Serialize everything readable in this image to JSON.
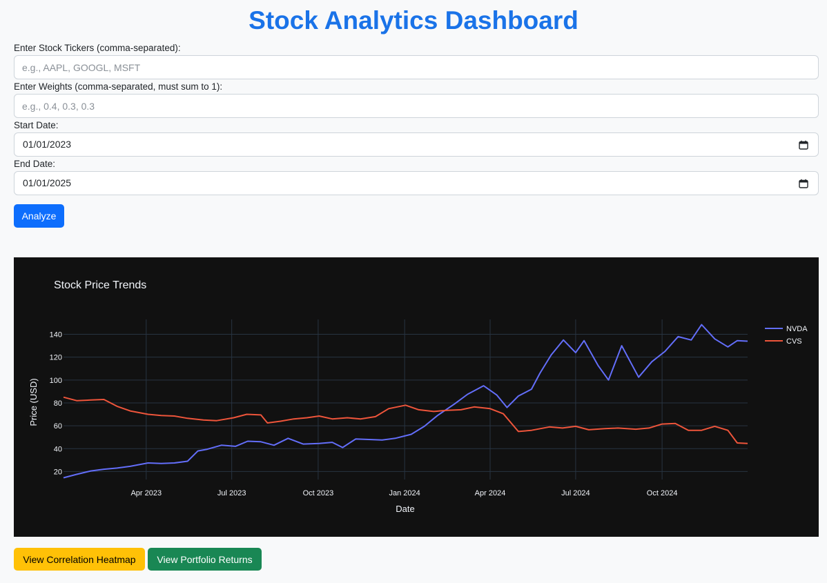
{
  "header": {
    "title": "Stock Analytics Dashboard"
  },
  "form": {
    "tickers_label": "Enter Stock Tickers (comma-separated):",
    "tickers_placeholder": "e.g., AAPL, GOOGL, MSFT",
    "tickers_value": "",
    "weights_label": "Enter Weights (comma-separated, must sum to 1):",
    "weights_placeholder": "e.g., 0.4, 0.3, 0.3",
    "weights_value": "",
    "start_label": "Start Date:",
    "start_value": "01/01/2023",
    "end_label": "End Date:",
    "end_value": "01/01/2025",
    "calendar_icon": "calendar-icon",
    "analyze_label": "Analyze"
  },
  "actions": {
    "heatmap_label": "View Correlation Heatmap",
    "portfolio_label": "View Portfolio Returns"
  },
  "colors": {
    "title": "#1a73e8",
    "primary": "#0d6efd",
    "warning": "#ffc107",
    "success": "#198754",
    "chart_bg": "#111111",
    "grid": "#283442"
  },
  "chart_data": {
    "type": "line",
    "title": "Stock Price Trends",
    "xlabel": "Date",
    "ylabel": "Price (USD)",
    "xlim": [
      "2023-01-03",
      "2024-12-31"
    ],
    "ylim": [
      13,
      153
    ],
    "yticks": [
      20,
      40,
      60,
      80,
      100,
      120,
      140
    ],
    "xticks": [
      {
        "date": "2023-04-01",
        "label": "Apr 2023"
      },
      {
        "date": "2023-07-01",
        "label": "Jul 2023"
      },
      {
        "date": "2023-10-01",
        "label": "Oct 2023"
      },
      {
        "date": "2024-01-01",
        "label": "Jan 2024"
      },
      {
        "date": "2024-04-01",
        "label": "Apr 2024"
      },
      {
        "date": "2024-07-01",
        "label": "Jul 2024"
      },
      {
        "date": "2024-10-01",
        "label": "Oct 2024"
      }
    ],
    "grid": true,
    "legend_position": "top-right",
    "series": [
      {
        "name": "NVDA",
        "color": "#636efa",
        "points": [
          [
            "2023-01-03",
            14.5
          ],
          [
            "2023-01-17",
            17.5
          ],
          [
            "2023-02-01",
            20.5
          ],
          [
            "2023-02-15",
            22.0
          ],
          [
            "2023-03-01",
            23.0
          ],
          [
            "2023-03-15",
            24.5
          ],
          [
            "2023-04-03",
            27.5
          ],
          [
            "2023-04-17",
            27.0
          ],
          [
            "2023-05-01",
            27.5
          ],
          [
            "2023-05-15",
            29.0
          ],
          [
            "2023-05-26",
            38.0
          ],
          [
            "2023-06-05",
            39.5
          ],
          [
            "2023-06-20",
            43.0
          ],
          [
            "2023-07-05",
            42.0
          ],
          [
            "2023-07-18",
            46.5
          ],
          [
            "2023-08-01",
            46.0
          ],
          [
            "2023-08-15",
            43.0
          ],
          [
            "2023-08-30",
            49.0
          ],
          [
            "2023-09-15",
            44.0
          ],
          [
            "2023-10-02",
            44.5
          ],
          [
            "2023-10-16",
            45.5
          ],
          [
            "2023-10-27",
            41.0
          ],
          [
            "2023-11-10",
            48.5
          ],
          [
            "2023-11-24",
            48.0
          ],
          [
            "2023-12-08",
            47.5
          ],
          [
            "2023-12-22",
            49.0
          ],
          [
            "2024-01-08",
            52.5
          ],
          [
            "2024-01-22",
            59.5
          ],
          [
            "2024-02-05",
            69.0
          ],
          [
            "2024-02-23",
            79.0
          ],
          [
            "2024-03-08",
            87.5
          ],
          [
            "2024-03-25",
            95.0
          ],
          [
            "2024-04-08",
            87.0
          ],
          [
            "2024-04-19",
            76.0
          ],
          [
            "2024-05-01",
            86.0
          ],
          [
            "2024-05-15",
            92.0
          ],
          [
            "2024-05-24",
            106.0
          ],
          [
            "2024-06-05",
            122.0
          ],
          [
            "2024-06-18",
            135.0
          ],
          [
            "2024-07-01",
            124.0
          ],
          [
            "2024-07-10",
            134.5
          ],
          [
            "2024-07-25",
            112.5
          ],
          [
            "2024-08-05",
            100.0
          ],
          [
            "2024-08-19",
            130.0
          ],
          [
            "2024-09-06",
            102.5
          ],
          [
            "2024-09-20",
            116.0
          ],
          [
            "2024-10-04",
            125.0
          ],
          [
            "2024-10-18",
            138.0
          ],
          [
            "2024-11-01",
            135.0
          ],
          [
            "2024-11-12",
            148.5
          ],
          [
            "2024-11-26",
            136.0
          ],
          [
            "2024-12-10",
            129.0
          ],
          [
            "2024-12-20",
            134.5
          ],
          [
            "2024-12-31",
            134.0
          ]
        ]
      },
      {
        "name": "CVS",
        "color": "#ef553b",
        "points": [
          [
            "2023-01-03",
            85.0
          ],
          [
            "2023-01-17",
            82.0
          ],
          [
            "2023-02-01",
            82.5
          ],
          [
            "2023-02-15",
            83.0
          ],
          [
            "2023-03-01",
            77.0
          ],
          [
            "2023-03-15",
            73.0
          ],
          [
            "2023-04-03",
            70.0
          ],
          [
            "2023-04-17",
            69.0
          ],
          [
            "2023-05-01",
            68.5
          ],
          [
            "2023-05-15",
            66.5
          ],
          [
            "2023-06-01",
            65.0
          ],
          [
            "2023-06-15",
            64.5
          ],
          [
            "2023-07-03",
            67.0
          ],
          [
            "2023-07-17",
            70.0
          ],
          [
            "2023-08-01",
            69.5
          ],
          [
            "2023-08-08",
            62.5
          ],
          [
            "2023-08-22",
            64.0
          ],
          [
            "2023-09-05",
            66.0
          ],
          [
            "2023-09-19",
            67.0
          ],
          [
            "2023-10-02",
            68.5
          ],
          [
            "2023-10-16",
            66.0
          ],
          [
            "2023-11-01",
            67.0
          ],
          [
            "2023-11-15",
            66.0
          ],
          [
            "2023-12-01",
            68.0
          ],
          [
            "2023-12-15",
            75.0
          ],
          [
            "2024-01-02",
            78.0
          ],
          [
            "2024-01-16",
            74.0
          ],
          [
            "2024-02-01",
            72.5
          ],
          [
            "2024-02-15",
            73.5
          ],
          [
            "2024-03-01",
            74.0
          ],
          [
            "2024-03-15",
            76.5
          ],
          [
            "2024-04-01",
            75.0
          ],
          [
            "2024-04-15",
            70.5
          ],
          [
            "2024-05-01",
            55.0
          ],
          [
            "2024-05-15",
            56.0
          ],
          [
            "2024-06-03",
            59.0
          ],
          [
            "2024-06-17",
            58.0
          ],
          [
            "2024-07-01",
            59.5
          ],
          [
            "2024-07-15",
            56.5
          ],
          [
            "2024-08-01",
            57.5
          ],
          [
            "2024-08-15",
            58.0
          ],
          [
            "2024-09-03",
            57.0
          ],
          [
            "2024-09-17",
            58.0
          ],
          [
            "2024-10-01",
            61.5
          ],
          [
            "2024-10-15",
            62.0
          ],
          [
            "2024-10-29",
            56.0
          ],
          [
            "2024-11-12",
            56.0
          ],
          [
            "2024-11-26",
            59.5
          ],
          [
            "2024-12-10",
            56.0
          ],
          [
            "2024-12-20",
            45.0
          ],
          [
            "2024-12-31",
            44.5
          ]
        ]
      }
    ]
  }
}
